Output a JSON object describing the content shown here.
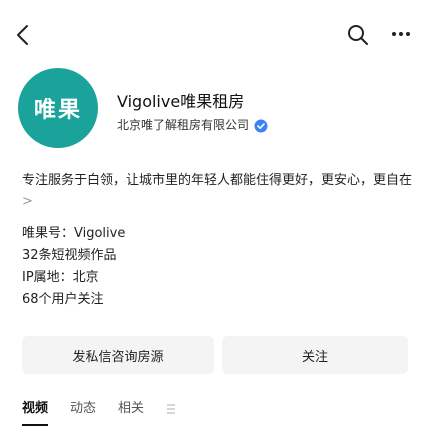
{
  "header": {
    "back_icon": "back-arrow-icon",
    "search_icon": "search-icon",
    "more_icon": "more-dots-icon"
  },
  "profile": {
    "avatar_text": "唯果",
    "name": "Vigolive唯果租房",
    "verification": "北京唯了解租房有限公司",
    "verify_badge_icon": "verified-badge-icon",
    "accent_color": "#1aa39a",
    "badge_color": "#3b82f6"
  },
  "about": {
    "description": "专注服务于白领，让城市里的年轻人都能住得更好，更安心，更自在",
    "expand_symbol": ">",
    "account_id": "唯果号：Vigolive",
    "following_text": "32条短视频作品",
    "ip_location": "IP属地：北京",
    "followers_text": "68个用户关注"
  },
  "actions": {
    "left_button": "发私信咨询房源",
    "right_button": "关注"
  },
  "tabs": [
    {
      "label": "视频",
      "active": true
    },
    {
      "label": "动态",
      "active": false
    },
    {
      "label": "相关",
      "active": false
    }
  ]
}
